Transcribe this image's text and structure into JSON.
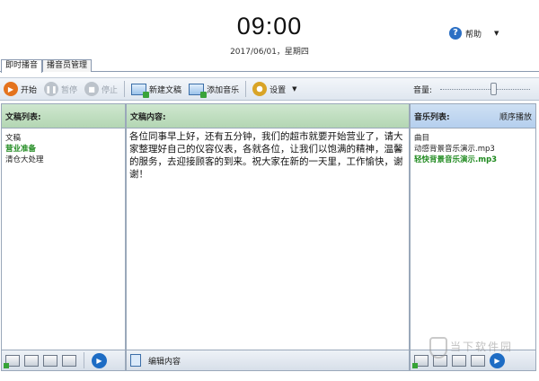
{
  "clock": {
    "time": "09:00",
    "date": "2017/06/01，星期四"
  },
  "help": {
    "label": "帮助"
  },
  "tabs": [
    {
      "label": "即时播音"
    },
    {
      "label": "播音员管理"
    }
  ],
  "toolbar": {
    "start": "开始",
    "pause": "暂停",
    "stop": "停止",
    "new_doc": "新建文稿",
    "add_music": "添加音乐",
    "settings": "设置",
    "volume_label": "音量:",
    "volume_level": 0.6
  },
  "left_panel": {
    "header": "文稿列表:",
    "items": [
      "文稿",
      "营业准备",
      "清仓大处理"
    ]
  },
  "middle_panel": {
    "header": "文稿内容:",
    "content": "各位同事早上好，还有五分钟，我们的超市就要开始营业了，请大家整理好自己的仪容仪表，各就各位，让我们以饱满的精神，温馨的服务，去迎接顾客的到来。祝大家在新的一天里，工作愉快，谢谢！",
    "edit_label": "编辑内容"
  },
  "right_panel": {
    "header": "音乐列表:",
    "play_mode": "顺序播放",
    "items": [
      "曲目",
      "动感背景音乐演示.mp3",
      "轻快背景音乐演示.mp3"
    ]
  },
  "watermark": {
    "text": "当下软件园"
  },
  "colors": {
    "accent_green": "#1f8a1f",
    "play_orange": "#e4731e",
    "play_blue": "#1d6cc4"
  }
}
